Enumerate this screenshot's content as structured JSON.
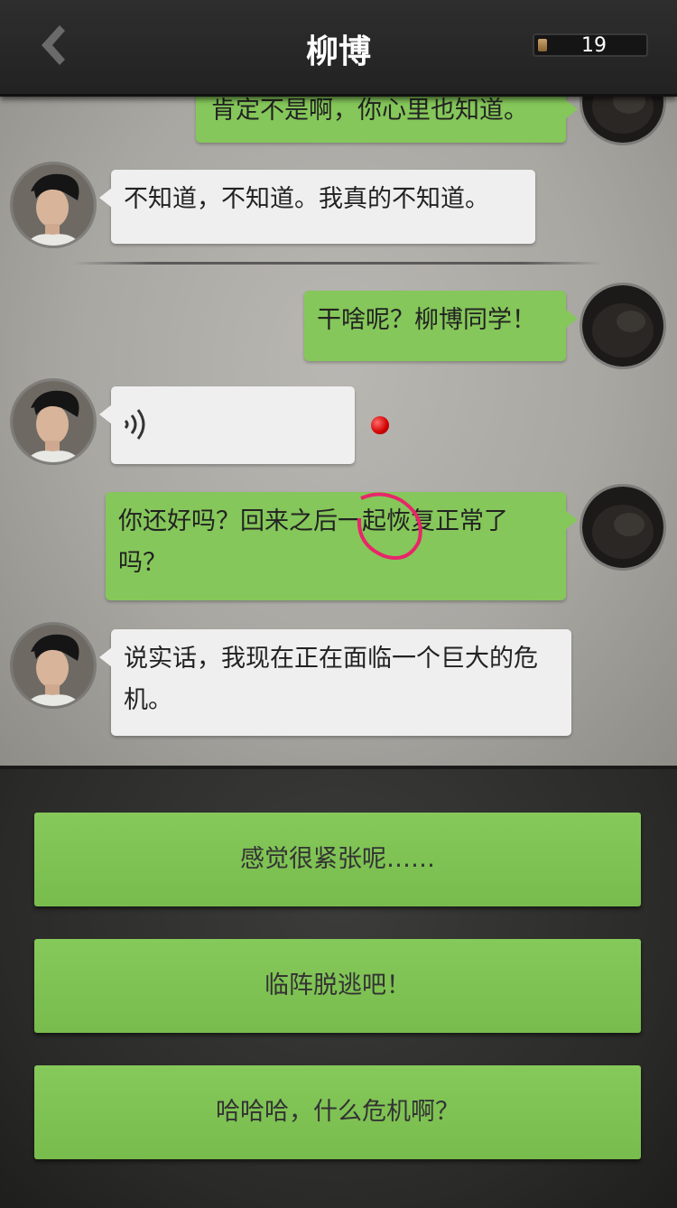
{
  "header": {
    "title": "柳博",
    "counter_value": "19",
    "back_icon": "chevron-left-icon"
  },
  "messages": [
    {
      "side": "me",
      "text": "肯定不是啊，你心里也知道。"
    },
    {
      "side": "them",
      "text": "不知道，不知道。我真的不知道。"
    },
    {
      "side": "me",
      "text": "干啥呢？柳博同学！"
    },
    {
      "side": "them",
      "type": "voice",
      "icon": "voice-wave-icon",
      "unread": true
    },
    {
      "side": "me",
      "text": "你还好吗？回来之后一起恢复正常了吗？"
    },
    {
      "side": "them",
      "text": "说实话，我现在正在面临一个巨大的危机。"
    }
  ],
  "options": [
    {
      "label": "感觉很紧张呢……"
    },
    {
      "label": "临阵脱逃吧！"
    },
    {
      "label": "哈哈哈，什么危机啊？"
    }
  ],
  "colors": {
    "my_bubble": "#85c75a",
    "their_bubble": "#efefef",
    "option_button": "#80c454",
    "annotation_circle": "#e8266a",
    "unread_dot": "#d10000"
  }
}
